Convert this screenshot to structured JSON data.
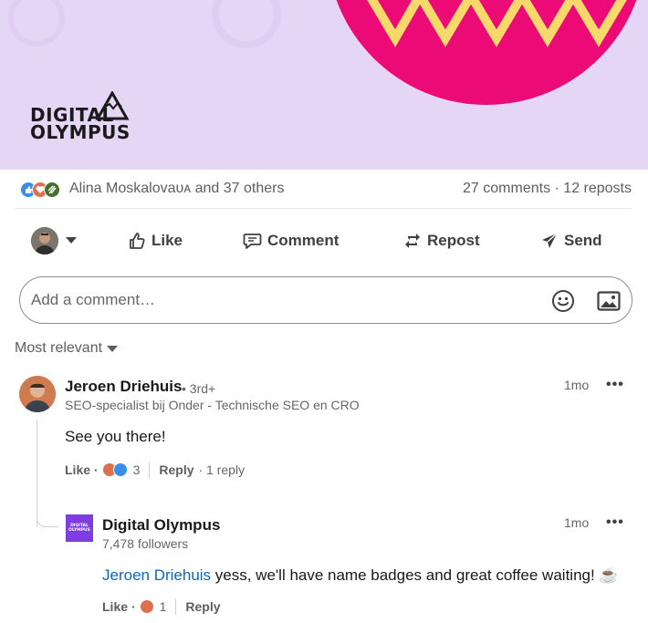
{
  "banner": {
    "logo": {
      "line1": "DIGITAL",
      "line2": "OLYMPUS"
    },
    "colors": {
      "background": "#e6d6f5",
      "circle": "#ec0b76",
      "zigzag": "#f7d86a"
    }
  },
  "post_stats": {
    "reactor_names": "Alina Moskalovaᴜᴀ and 37 others",
    "comments_reposts": "27 comments · 12 reposts",
    "reaction_icons": [
      "like-icon",
      "love-icon",
      "insightful-icon"
    ]
  },
  "actions": {
    "like": "Like",
    "comment": "Comment",
    "repost": "Repost",
    "send": "Send"
  },
  "comment_box": {
    "placeholder": "Add a comment…"
  },
  "sort": {
    "label": "Most relevant"
  },
  "comments": [
    {
      "author": "Jeroen Driehuis",
      "degree": "• 3rd+",
      "headline": "SEO-specialist bij Onder - Technische SEO en CRO",
      "time": "1mo",
      "more": "•••",
      "text": "See you there!",
      "like": "Like ·",
      "reaction_count": "3",
      "reply": "Reply",
      "replies": "· 1 reply"
    },
    {
      "author": "Digital Olympus",
      "followers": "7,478 followers",
      "time": "1mo",
      "more": "•••",
      "mention": "Jeroen Driehuis",
      "text": " yess, we'll have name badges and great coffee waiting! ☕",
      "like": "Like ·",
      "reaction_count": "1",
      "reply": "Reply",
      "avatar_text": [
        "DIGITAL",
        "OLYMPUS"
      ]
    }
  ],
  "colors": {
    "accent": "#0a66c2",
    "like_blue": "#378fe9",
    "love_red": "#df704d",
    "insightful_green": "#44712e"
  }
}
